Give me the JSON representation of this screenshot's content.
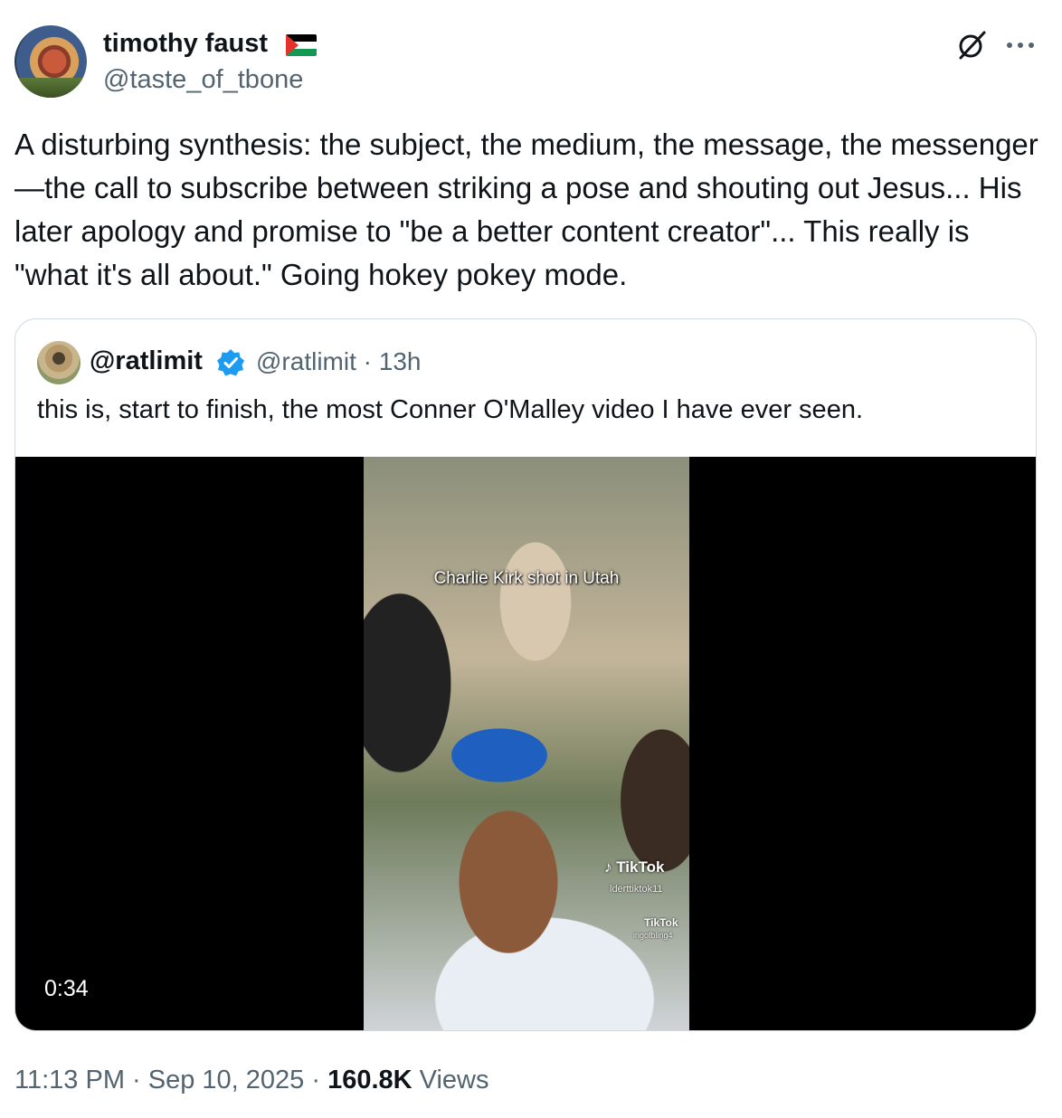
{
  "author": {
    "display_name": "timothy faust",
    "handle": "@taste_of_tbone",
    "flag_icon": "palestine-flag-icon"
  },
  "header_actions": {
    "grok_icon": "grok-icon",
    "more_icon": "more-icon"
  },
  "tweet": {
    "text": "A disturbing synthesis: the subject, the medium, the message, the messenger—the call to subscribe between striking a pose and shouting out Jesus... His later apology and promise to \"be a better content creator\"... This really is \"what it's all about.\" Going hokey pokey mode."
  },
  "quoted": {
    "display_name": "@ratlimit",
    "handle_time": "@ratlimit · 13h",
    "verified_color": "#1d9bf0",
    "text": "this is, start to finish, the most Conner O'Malley video I have ever seen.",
    "video": {
      "caption": "Charlie Kirk shot in Utah",
      "watermark": "TikTok",
      "watermark_user": "lderttiktok11",
      "watermark2": "TikTok",
      "watermark_user2": "ingofbling4",
      "duration": "0:34"
    }
  },
  "footer": {
    "time": "11:13 PM",
    "date": "Sep 10, 2025",
    "views_count": "160.8K",
    "views_label": "Views"
  },
  "colors": {
    "text": "#0f1419",
    "secondary": "#536471",
    "border": "#cfd9de"
  }
}
